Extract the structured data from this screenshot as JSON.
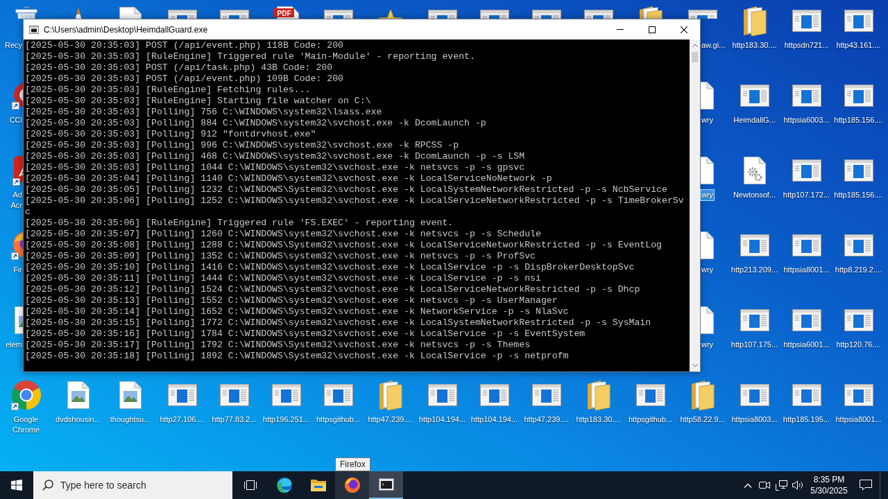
{
  "desktop": {
    "top_row": [
      {
        "kind": "recycle_bin",
        "label": "Recy",
        "selected": false
      },
      {
        "kind": "cone",
        "selected": false
      },
      {
        "kind": "file",
        "selected": false
      },
      {
        "kind": "app",
        "selected": false
      },
      {
        "kind": "app",
        "selected": false
      },
      {
        "kind": "pdf",
        "badge": "PDF",
        "selected": false
      },
      {
        "kind": "app",
        "selected": false
      },
      {
        "kind": "star",
        "selected": false
      },
      {
        "kind": "app",
        "selected": false
      },
      {
        "kind": "app",
        "selected": false
      },
      {
        "kind": "app",
        "selected": false
      },
      {
        "kind": "app",
        "selected": false
      },
      {
        "kind": "folder",
        "selected": false
      },
      {
        "kind": "app",
        "label": "aw.gi...",
        "selected": false
      },
      {
        "kind": "folder",
        "label": "http183.30....",
        "selected": false
      },
      {
        "kind": "app",
        "label": "httpsdn721...",
        "selected": false
      },
      {
        "kind": "app",
        "label": "http43.161....",
        "selected": false
      }
    ],
    "middle_rows": [
      [
        {
          "kind": "round_logo",
          "label": "CCl",
          "selected": false
        },
        {
          "kind": "file",
          "label": "wry",
          "selected": false
        },
        {
          "kind": "app",
          "label": "HeimdallG...",
          "selected": false
        },
        {
          "kind": "app",
          "label": "httpsia6003...",
          "selected": false
        },
        {
          "kind": "app",
          "label": "http185.156....",
          "selected": false
        }
      ],
      [
        {
          "kind": "swirl_logo",
          "label": "Ad Acr",
          "selected": false
        },
        {
          "kind": "file",
          "label": "wry",
          "selected": true
        },
        {
          "kind": "gear_file",
          "label": "Newtonsof...",
          "selected": false
        },
        {
          "kind": "app",
          "label": "http107.172...",
          "selected": false
        },
        {
          "kind": "app",
          "label": "http185.156....",
          "selected": false
        }
      ],
      [
        {
          "kind": "globe_logo",
          "label": "Fir",
          "selected": false
        },
        {
          "kind": "file",
          "label": "wry",
          "selected": false
        },
        {
          "kind": "app",
          "label": "http213.209...",
          "selected": false
        },
        {
          "kind": "app",
          "label": "httpsia8001...",
          "selected": false
        },
        {
          "kind": "app",
          "label": "http8.219.2....",
          "selected": false
        }
      ],
      [
        {
          "kind": "image_file",
          "label": "elem",
          "selected": false
        },
        {
          "kind": "file",
          "label": "wry",
          "selected": false
        },
        {
          "kind": "app",
          "label": "http107.175...",
          "selected": false
        },
        {
          "kind": "app",
          "label": "httpsia6001...",
          "selected": false
        },
        {
          "kind": "app",
          "label": "http120.76....",
          "selected": false
        }
      ]
    ],
    "bottom_row": [
      {
        "kind": "chrome",
        "label": "Google Chrome",
        "selected": false
      },
      {
        "kind": "image_file",
        "label": "dvdshousin...",
        "selected": false
      },
      {
        "kind": "image_file",
        "label": "thoughtsu...",
        "selected": false
      },
      {
        "kind": "app",
        "label": "http27.106....",
        "selected": false
      },
      {
        "kind": "app",
        "label": "http77.83.2...",
        "selected": false
      },
      {
        "kind": "app",
        "label": "http196.251...",
        "selected": false
      },
      {
        "kind": "app",
        "label": "httpsgithub...",
        "selected": false
      },
      {
        "kind": "folder",
        "label": "http47.239....",
        "selected": false
      },
      {
        "kind": "app",
        "label": "http104.194...",
        "selected": false
      },
      {
        "kind": "app",
        "label": "http104.194...",
        "selected": false
      },
      {
        "kind": "app",
        "label": "http47.239....",
        "selected": false
      },
      {
        "kind": "folder",
        "label": "http183.30....",
        "selected": false
      },
      {
        "kind": "app",
        "label": "httpsgithub...",
        "selected": false
      },
      {
        "kind": "folder",
        "label": "http58.22.9...",
        "selected": false
      },
      {
        "kind": "app",
        "label": "httpsia8003...",
        "selected": false
      },
      {
        "kind": "app",
        "label": "http185.195...",
        "selected": false
      },
      {
        "kind": "app",
        "label": "httpsia8001...",
        "selected": false
      }
    ]
  },
  "console_window": {
    "title": "C:\\Users\\admin\\Desktop\\HeimdallGuard.exe",
    "lines": [
      "[2025-05-30 20:35:03] POST (/api/event.php) 118B Code: 200",
      "[2025-05-30 20:35:03] [RuleEngine] Triggered rule 'Main-Module' - reporting event.",
      "[2025-05-30 20:35:03] POST (/api/task.php) 43B Code: 200",
      "[2025-05-30 20:35:03] POST (/api/event.php) 109B Code: 200",
      "[2025-05-30 20:35:03] [RuleEngine] Fetching rules...",
      "[2025-05-30 20:35:03] [RuleEngine] Starting file watcher on C:\\",
      "[2025-05-30 20:35:03] [Polling] 756 C:\\WINDOWS\\system32\\lsass.exe",
      "[2025-05-30 20:35:03] [Polling] 884 C:\\WINDOWS\\system32\\svchost.exe -k DcomLaunch -p",
      "[2025-05-30 20:35:03] [Polling] 912 \"fontdrvhost.exe\"",
      "[2025-05-30 20:35:03] [Polling] 996 C:\\WINDOWS\\system32\\svchost.exe -k RPCSS -p",
      "[2025-05-30 20:35:03] [Polling] 468 C:\\WINDOWS\\system32\\svchost.exe -k DcomLaunch -p -s LSM",
      "[2025-05-30 20:35:03] [Polling] 1044 C:\\WINDOWS\\system32\\svchost.exe -k netsvcs -p -s gpsvc",
      "[2025-05-30 20:35:04] [Polling] 1140 C:\\WINDOWS\\system32\\svchost.exe -k LocalServiceNoNetwork -p",
      "[2025-05-30 20:35:05] [Polling] 1232 C:\\WINDOWS\\System32\\svchost.exe -k LocalSystemNetworkRestricted -p -s NcbService",
      "[2025-05-30 20:35:06] [Polling] 1252 C:\\WINDOWS\\system32\\svchost.exe -k LocalServiceNetworkRestricted -p -s TimeBrokerSv",
      "c",
      "[2025-05-30 20:35:06] [RuleEngine] Triggered rule 'FS.EXEC' - reporting event.",
      "[2025-05-30 20:35:07] [Polling] 1260 C:\\WINDOWS\\system32\\svchost.exe -k netsvcs -p -s Schedule",
      "[2025-05-30 20:35:08] [Polling] 1288 C:\\WINDOWS\\System32\\svchost.exe -k LocalServiceNetworkRestricted -p -s EventLog",
      "[2025-05-30 20:35:09] [Polling] 1352 C:\\WINDOWS\\system32\\svchost.exe -k netsvcs -p -s ProfSvc",
      "[2025-05-30 20:35:10] [Polling] 1416 C:\\WINDOWS\\system32\\svchost.exe -k LocalService -p -s DispBrokerDesktopSvc",
      "[2025-05-30 20:35:11] [Polling] 1444 C:\\WINDOWS\\system32\\svchost.exe -k LocalService -p -s nsi",
      "[2025-05-30 20:35:12] [Polling] 1524 C:\\WINDOWS\\system32\\svchost.exe -k LocalServiceNetworkRestricted -p -s Dhcp",
      "[2025-05-30 20:35:13] [Polling] 1552 C:\\WINDOWS\\system32\\svchost.exe -k netsvcs -p -s UserManager",
      "[2025-05-30 20:35:14] [Polling] 1652 C:\\WINDOWS\\System32\\svchost.exe -k NetworkService -p -s NlaSvc",
      "[2025-05-30 20:35:15] [Polling] 1772 C:\\WINDOWS\\system32\\svchost.exe -k LocalSystemNetworkRestricted -p -s SysMain",
      "[2025-05-30 20:35:16] [Polling] 1784 C:\\WINDOWS\\system32\\svchost.exe -k LocalService -p -s EventSystem",
      "[2025-05-30 20:35:17] [Polling] 1792 C:\\WINDOWS\\System32\\svchost.exe -k netsvcs -p -s Themes",
      "[2025-05-30 20:35:18] [Polling] 1892 C:\\WINDOWS\\System32\\svchost.exe -k LocalService -p -s netprofm"
    ]
  },
  "tooltip": "Firefox",
  "taskbar": {
    "search": {
      "placeholder": "Type here to search"
    },
    "buttons": [
      {
        "kind": "task_view",
        "active": false,
        "hovered": false
      },
      {
        "kind": "edge",
        "active": false,
        "hovered": false
      },
      {
        "kind": "explorer",
        "active": false,
        "hovered": false
      },
      {
        "kind": "firefox",
        "active": false,
        "hovered": true
      },
      {
        "kind": "console",
        "active": true,
        "hovered": false
      }
    ],
    "clock": {
      "time": "8:35 PM",
      "date": "5/30/2025"
    }
  }
}
